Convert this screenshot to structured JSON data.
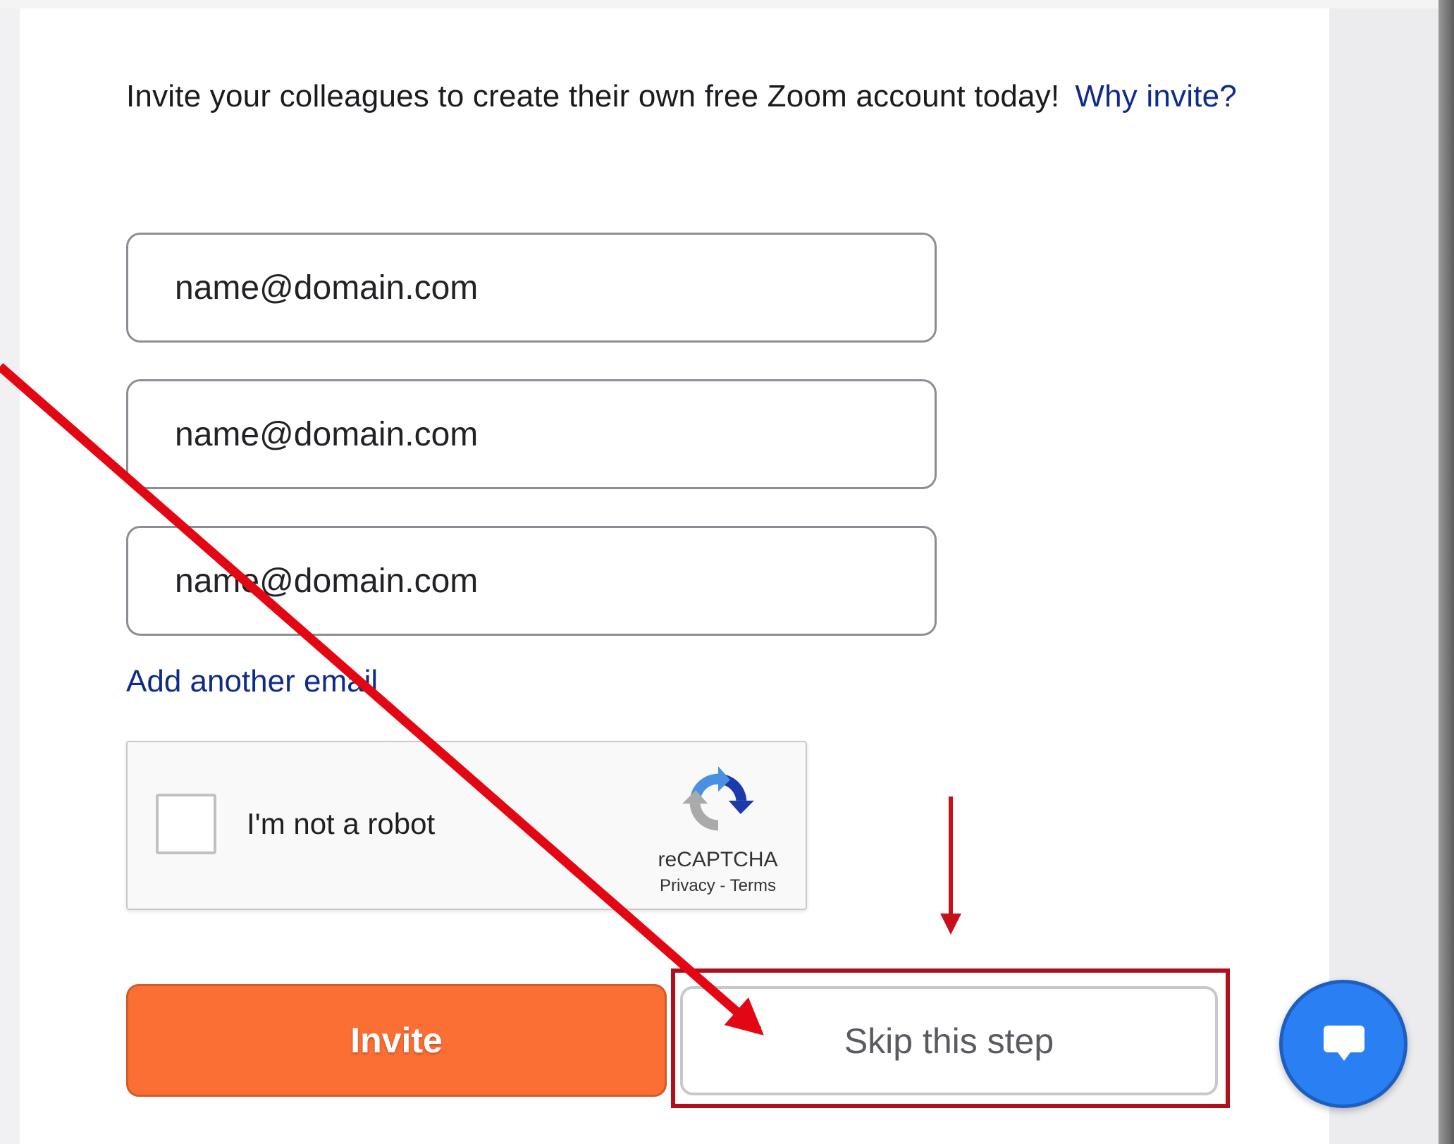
{
  "intro": {
    "text": "Invite your colleagues to create their own free Zoom account today!",
    "why_link": "Why invite?"
  },
  "emails": [
    {
      "placeholder": "name@domain.com"
    },
    {
      "placeholder": "name@domain.com"
    },
    {
      "placeholder": "name@domain.com"
    }
  ],
  "add_email": "Add another email",
  "captcha": {
    "label": "I'm not a robot",
    "brand": "reCAPTCHA",
    "privacy": "Privacy",
    "separator": " - ",
    "terms": "Terms"
  },
  "buttons": {
    "invite": "Invite",
    "skip": "Skip this step"
  },
  "colors": {
    "accent": "#fb6e34",
    "link": "#0e2b8c",
    "annotation": "#e30613",
    "highlight": "#b0101b",
    "chat": "#2a7ff2"
  },
  "icons": {
    "chat": "chat-bubble-icon",
    "captcha": "recaptcha-logo-icon"
  }
}
